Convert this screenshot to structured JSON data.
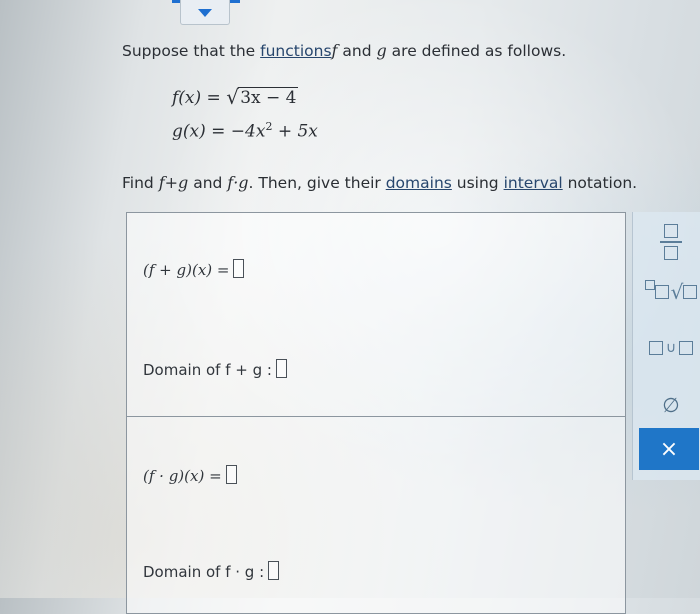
{
  "problem": {
    "intro_pre": "Suppose that the ",
    "intro_link": "functions",
    "intro_f": "f",
    "intro_mid": " and ",
    "intro_g": "g",
    "intro_post": " are defined as follows.",
    "eq1_lhs": "f(x) = ",
    "eq1_rad": "3x − 4",
    "eq2_lhs": "g(x) = −4x",
    "eq2_sup": "2",
    "eq2_rest": " + 5x",
    "task_pre": "Find ",
    "task_sum": "f+g",
    "task_and": " and ",
    "task_prod": "f·g",
    "task_mid": ". Then, give their ",
    "task_link1": "domains",
    "task_using": " using ",
    "task_link2": "interval",
    "task_post": " notation."
  },
  "answers": {
    "sum_label": "(f + g)(x) =",
    "sum_domain_label": "Domain of f + g  :",
    "prod_label": "(f · g)(x) =",
    "prod_domain_label": "Domain of f · g  :"
  },
  "toolbar": {
    "fraction_icon": "fraction-icon",
    "sqrt_icon": "sqrt-icon",
    "union_symbol": "∪",
    "empty_set_symbol": "∅",
    "clear_symbol": "×"
  },
  "colors": {
    "accent": "#1e6fd0",
    "clear_button": "#1f76c8",
    "tool_icon": "#5b7d99"
  }
}
